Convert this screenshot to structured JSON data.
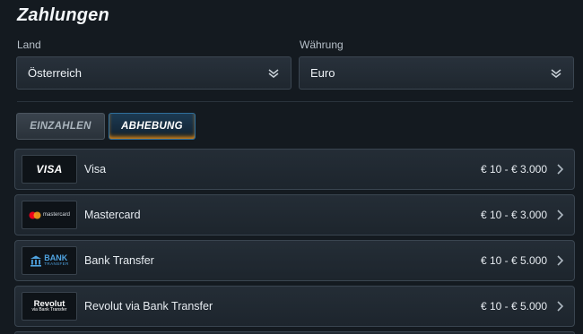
{
  "page": {
    "title": "Zahlungen"
  },
  "filters": {
    "country": {
      "label": "Land",
      "value": "Österreich"
    },
    "currency": {
      "label": "Währung",
      "value": "Euro"
    }
  },
  "tabs": [
    {
      "label": "EINZAHLEN",
      "active": false
    },
    {
      "label": "ABHEBUNG",
      "active": true
    }
  ],
  "methods": [
    {
      "name": "Visa",
      "range": "€ 10 - € 3.000",
      "logo_text": "VISA",
      "icon": "visa-logo"
    },
    {
      "name": "Mastercard",
      "range": "€ 10 - € 3.000",
      "logo_text": "mastercard",
      "icon": "mastercard-logo"
    },
    {
      "name": "Bank Transfer",
      "range": "€ 10 - € 5.000",
      "logo_text": "BANK",
      "logo_subtext": "TRANSFER",
      "icon": "bank-transfer-logo"
    },
    {
      "name": "Revolut via Bank Transfer",
      "range": "€ 10 - € 5.000",
      "logo_text": "Revolut",
      "logo_subtext": "via Bank Transfer",
      "icon": "revolut-logo"
    }
  ],
  "colors": {
    "background": "#141a20",
    "active_tab_border": "#2e6f9c",
    "active_tab_glow": "#e08a1e",
    "mastercard_red": "#eb001b",
    "mastercard_orange": "#f79e1b"
  }
}
